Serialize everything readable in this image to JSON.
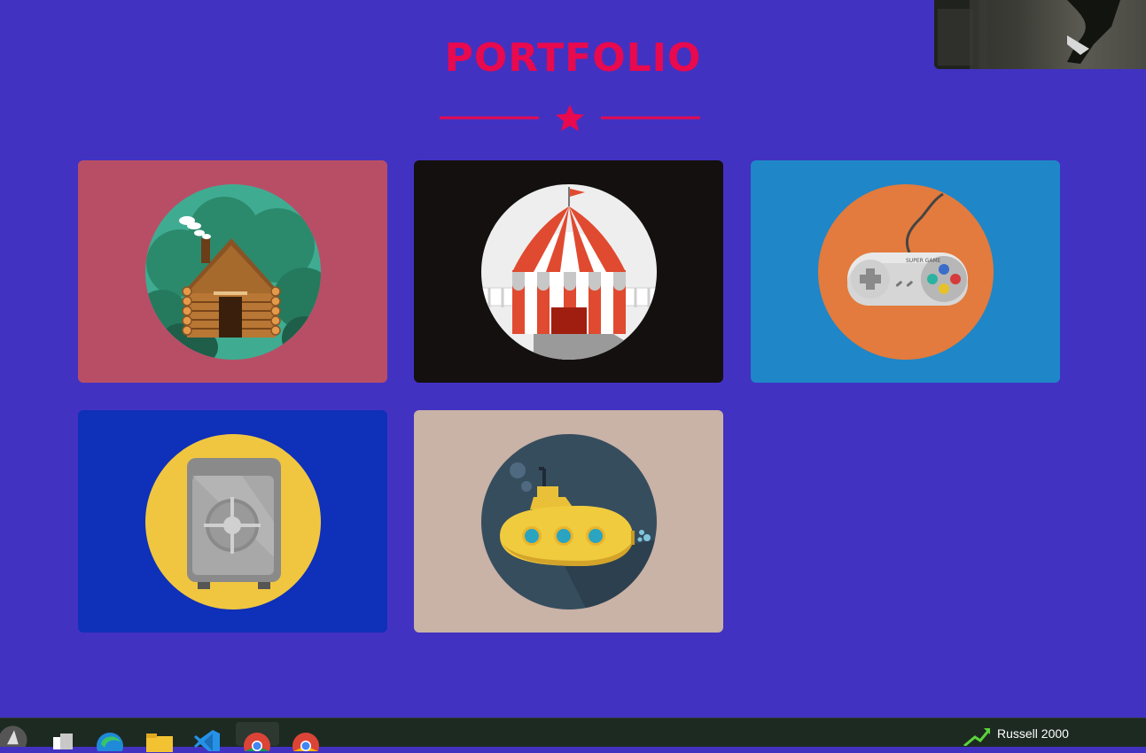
{
  "page": {
    "title": "PORTFOLIO"
  },
  "portfolio": {
    "items": [
      {
        "name": "log-cabin",
        "bg": "#b84e66",
        "circle": "#3fac92"
      },
      {
        "name": "circus-tent",
        "bg": "#141010",
        "circle": "#eeeeee"
      },
      {
        "name": "game-controller",
        "bg": "#1f86c8",
        "circle": "#e27b3d",
        "controller_label": "SUPER GAME"
      },
      {
        "name": "safe",
        "bg": "#0f30b8",
        "circle": "#f0c640"
      },
      {
        "name": "submarine",
        "bg": "#c9b2a6",
        "circle": "#364d5e"
      }
    ]
  },
  "colors": {
    "accent": "#e8094e",
    "background": "#4232c2"
  },
  "taskbar": {
    "icons": [
      "start-icon",
      "task-view-icon",
      "edge-icon",
      "file-explorer-icon",
      "vscode-icon",
      "chrome-icon",
      "chrome-icon"
    ],
    "ticker": {
      "label": "Russell 2000",
      "trend": "up"
    }
  }
}
